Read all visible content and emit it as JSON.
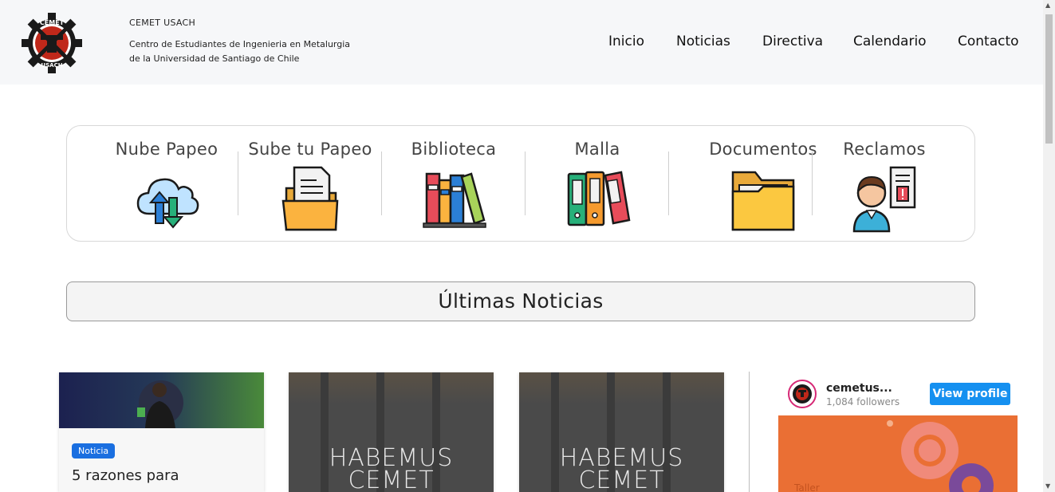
{
  "header": {
    "brand_title": "CEMET USACH",
    "brand_subtitle_line1": "Centro de Estudiantes de Ingenieria en Metalurgia",
    "brand_subtitle_line2": "de la Universidad de Santiago de Chile",
    "logo_text_top": "CEMET",
    "logo_text_bottom": "USACH",
    "nav": [
      {
        "label": "Inicio"
      },
      {
        "label": "Noticias"
      },
      {
        "label": "Directiva"
      },
      {
        "label": "Calendario"
      },
      {
        "label": "Contacto"
      }
    ]
  },
  "quick_links": [
    {
      "label": "Nube Papeo",
      "icon": "cloud-sync-icon"
    },
    {
      "label": "Sube tu Papeo",
      "icon": "folder-document-icon"
    },
    {
      "label": "Biblioteca",
      "icon": "books-icon"
    },
    {
      "label": "Malla",
      "icon": "binders-icon"
    },
    {
      "label": "Documentos",
      "icon": "folder-icon"
    },
    {
      "label": "Reclamos",
      "icon": "person-complaint-icon"
    }
  ],
  "news_heading": "Últimas Noticias",
  "news": [
    {
      "badge": "Noticia",
      "title": "5 razones para"
    },
    {
      "image_text_line1": "HABEMUS",
      "image_text_line2": "CEMET"
    },
    {
      "image_text_line1": "HABEMUS",
      "image_text_line2": "CEMET"
    }
  ],
  "instagram": {
    "username": "cemetus...",
    "followers": "1,084 followers",
    "button_label": "View profile",
    "post_text": "Taller"
  },
  "colors": {
    "header_bg": "#f6f7f9",
    "badge_blue": "#1a6fe0",
    "ig_button": "#1590f0",
    "ig_post": "#ea6f34"
  }
}
